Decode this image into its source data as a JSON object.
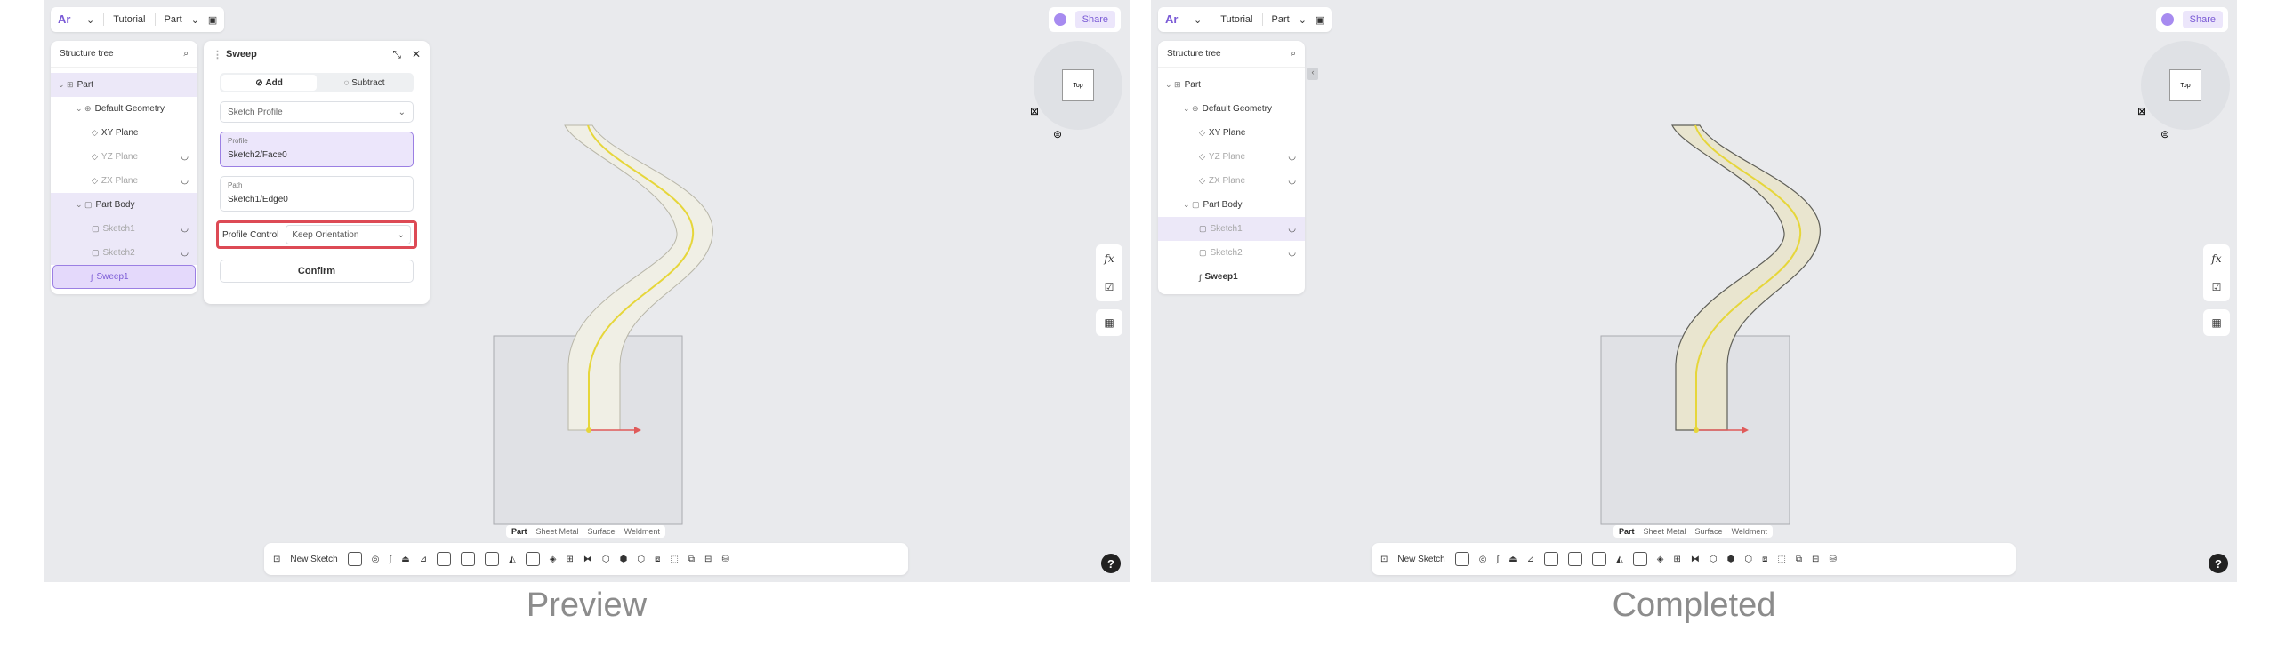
{
  "captions": {
    "preview": "Preview",
    "completed": "Completed"
  },
  "topbar": {
    "logo": "Ar",
    "tutorial": "Tutorial",
    "part": "Part",
    "share": "Share"
  },
  "tree": {
    "title": "Structure tree",
    "items": [
      {
        "label": "Part",
        "icon": "part-icon"
      },
      {
        "label": "Default Geometry",
        "icon": "geometry-icon"
      },
      {
        "label": "XY Plane",
        "icon": "plane-icon"
      },
      {
        "label": "YZ Plane",
        "icon": "plane-icon"
      },
      {
        "label": "ZX Plane",
        "icon": "plane-icon"
      },
      {
        "label": "Part Body",
        "icon": "body-icon"
      },
      {
        "label": "Sketch1",
        "icon": "sketch-icon"
      },
      {
        "label": "Sketch2",
        "icon": "sketch-icon"
      },
      {
        "label": "Sweep1",
        "icon": "sweep-icon"
      }
    ]
  },
  "dialog": {
    "title": "Sweep",
    "add": "Add",
    "subtract": "Subtract",
    "profile_type": "Sketch Profile",
    "profile_label": "Profile",
    "profile_value": "Sketch2/Face0",
    "path_label": "Path",
    "path_value": "Sketch1/Edge0",
    "profile_control_label": "Profile Control",
    "profile_control_value": "Keep Orientation",
    "confirm": "Confirm"
  },
  "viewcube": {
    "face": "Top"
  },
  "sidetools": {
    "fx": "fx"
  },
  "tabs": [
    "Part",
    "Sheet Metal",
    "Surface",
    "Weldment"
  ],
  "toolbar": {
    "new_sketch": "New Sketch"
  },
  "help": "?"
}
